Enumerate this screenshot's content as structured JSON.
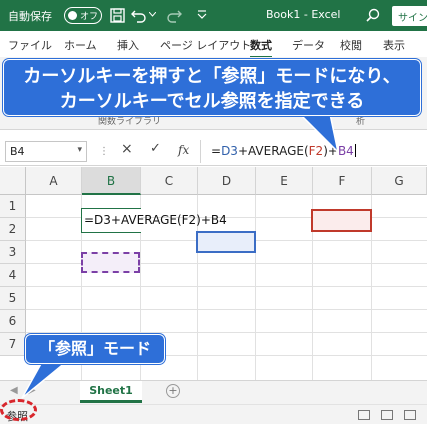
{
  "colors": {
    "excel_green": "#217346",
    "callout_blue": "#2e6fd8",
    "ref_blue": "#3b6dc5",
    "ref_red": "#c0392b",
    "ref_purple": "#7b3fa6",
    "ring_red": "#d8262c"
  },
  "titlebar": {
    "autosave_label": "自動保存",
    "autosave_state": "オフ",
    "title": "Book1 - Excel",
    "signin": "サインイ",
    "icons": [
      "save-icon",
      "undo-icon",
      "redo-icon",
      "dropdown-icon",
      "search-icon"
    ]
  },
  "ribbon": {
    "tabs": [
      "ファイル",
      "ホーム",
      "挿入",
      "ページ レイアウト",
      "数式",
      "データ",
      "校閲",
      "表示"
    ],
    "active_tab": "数式",
    "group_labels": [
      "関数ライブラリ",
      "ワークシート分析"
    ]
  },
  "formula_bar": {
    "name_box": "B4",
    "cancel_icon": "×",
    "enter_icon": "✓",
    "fx_icon": "fx",
    "formula_parts": [
      {
        "text": "=",
        "color": "plain"
      },
      {
        "text": "D3",
        "color": "blue"
      },
      {
        "text": "+AVERAGE(",
        "color": "plain"
      },
      {
        "text": "F2",
        "color": "red"
      },
      {
        "text": ")+",
        "color": "plain"
      },
      {
        "text": "B4",
        "color": "purple"
      }
    ]
  },
  "grid": {
    "columns": [
      "A",
      "B",
      "C",
      "D",
      "E",
      "F",
      "G"
    ],
    "selected_column": "B",
    "rows": [
      "1",
      "2",
      "3",
      "4",
      "5",
      "6",
      "7"
    ],
    "editing_cell": "B2",
    "editing_text": "=D3+AVERAGE(F2)+B4",
    "references": [
      {
        "cell": "D3",
        "color": "#3b6dc5",
        "style": "solid"
      },
      {
        "cell": "F2",
        "color": "#c0392b",
        "style": "solid"
      },
      {
        "cell": "B4",
        "color": "#7b3fa6",
        "style": "dashed"
      }
    ]
  },
  "sheets": {
    "tabs": [
      "Sheet1"
    ],
    "active": "Sheet1",
    "add_icon": "+"
  },
  "status": {
    "mode": "参照"
  },
  "callouts": {
    "main_line1": "カーソルキーを押すと「参照」モードになり、",
    "main_line2": "カーソルキーでセル参照を指定できる",
    "mode_label": "「参照」モード"
  }
}
